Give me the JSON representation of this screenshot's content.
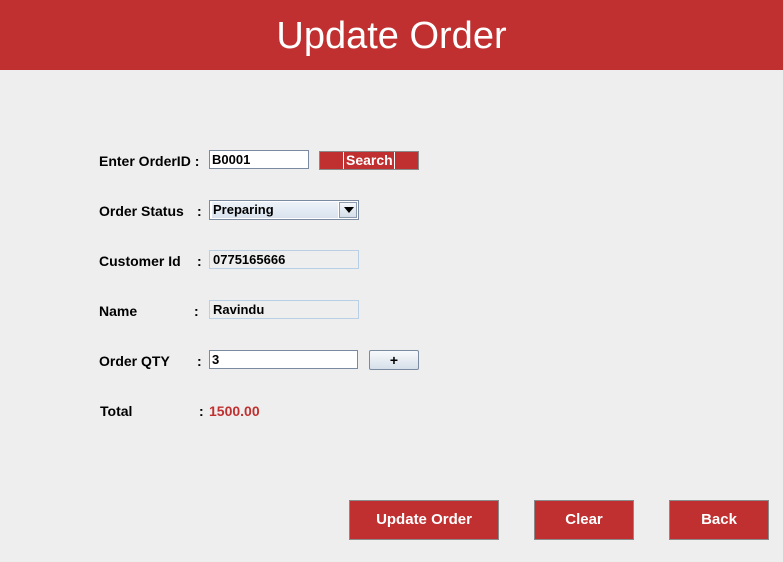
{
  "header": {
    "title": "Update Order"
  },
  "form": {
    "order_id": {
      "label": "Enter OrderID :",
      "value": "B0001"
    },
    "search_label": "Search",
    "order_status": {
      "label": "Order Status",
      "colon": ":",
      "selected": "Preparing"
    },
    "customer_id": {
      "label": "Customer Id",
      "colon": ":",
      "value": "0775165666"
    },
    "name": {
      "label": "Name",
      "colon": ":",
      "value": "Ravindu"
    },
    "order_qty": {
      "label": "Order QTY",
      "colon": ":",
      "value": "3"
    },
    "plus_label": "+",
    "total": {
      "label": "Total",
      "colon": ":",
      "value": "1500.00"
    }
  },
  "actions": {
    "update_label": "Update Order",
    "clear_label": "Clear",
    "back_label": "Back"
  },
  "colors": {
    "accent": "#c03030",
    "background": "#eeeeee",
    "total_value": "#c03030"
  }
}
